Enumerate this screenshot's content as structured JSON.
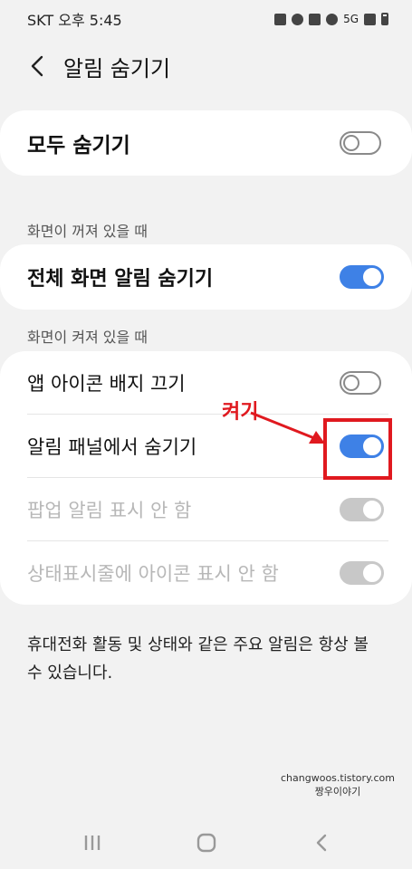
{
  "status_bar": {
    "carrier_time": "SKT 오후 5:45",
    "network": "5G"
  },
  "header": {
    "title": "알림 숨기기"
  },
  "hide_all": {
    "label": "모두 숨기기",
    "enabled": false
  },
  "section_screen_off": {
    "title": "화면이 꺼져 있을 때",
    "items": [
      {
        "label": "전체 화면 알림 숨기기",
        "enabled": true
      }
    ]
  },
  "section_screen_on": {
    "title": "화면이 켜져 있을 때",
    "items": [
      {
        "label": "앱 아이콘 배지 끄기",
        "enabled": false,
        "disabled": false
      },
      {
        "label": "알림 패널에서 숨기기",
        "enabled": true,
        "disabled": false
      },
      {
        "label": "팝업 알림 표시 안 함",
        "enabled": true,
        "disabled": true
      },
      {
        "label": "상태표시줄에 아이콘 표시 안 함",
        "enabled": true,
        "disabled": true
      }
    ]
  },
  "annotation": {
    "label": "켜기",
    "color": "#e0191f"
  },
  "footer_note": "휴대전화 활동 및 상태와 같은 주요 알림은 항상 볼 수 있습니다.",
  "watermark": {
    "line1": "changwoos.tistory.com",
    "line2": "짱우이야기"
  },
  "colors": {
    "accent": "#3e81e6",
    "background": "#f2f2f2",
    "card": "#ffffff"
  }
}
